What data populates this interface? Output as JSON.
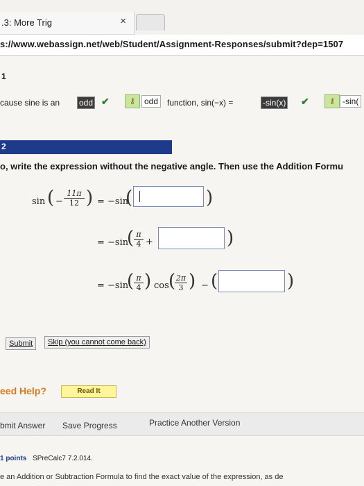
{
  "browser": {
    "tab_title": ".3: More Trig",
    "tab_close": "×",
    "url": "s://www.webassign.net/web/Student/Assignment-Responses/submit?dep=1507"
  },
  "q1": {
    "number": "1",
    "text_prefix": "cause sine is an",
    "answer_odd": "odd",
    "key_glyph": "⚷",
    "answer_odd2": "odd",
    "text_function": "function,  sin(−x) =",
    "answer_sinx": "-sin(x)",
    "answer_sin_partial": "-sin(",
    "check": "✔"
  },
  "q2": {
    "number": "2",
    "instruction": "o, write the expression without the negative angle. Then use the Addition Formu",
    "row1": {
      "lhs": "sin",
      "minus": "−",
      "frac_num": "11π",
      "frac_den": "12",
      "equals": "=  −sin"
    },
    "row2": {
      "equals": "=  −sin",
      "frac_num": "π",
      "frac_den": "4",
      "plus": "+"
    },
    "row3": {
      "equals": "=  −sin",
      "frac1_num": "π",
      "frac1_den": "4",
      "cos": "cos",
      "frac2_num": "2π",
      "frac2_den": "3",
      "minus": "−"
    },
    "submit_label": "Submit",
    "skip_label": "Skip (you cannot come back)"
  },
  "help": {
    "need_help": "eed Help?",
    "read_it": "Read It"
  },
  "actions": {
    "submit_answer": "bmit Answer",
    "save_progress": "Save Progress",
    "practice_another": "Practice Another Version"
  },
  "q3": {
    "points": "1 points",
    "source": "SPreCalc7 7.2.014.",
    "instruction": "e an Addition or Subtraction Formula to find the exact value of the expression, as de"
  }
}
